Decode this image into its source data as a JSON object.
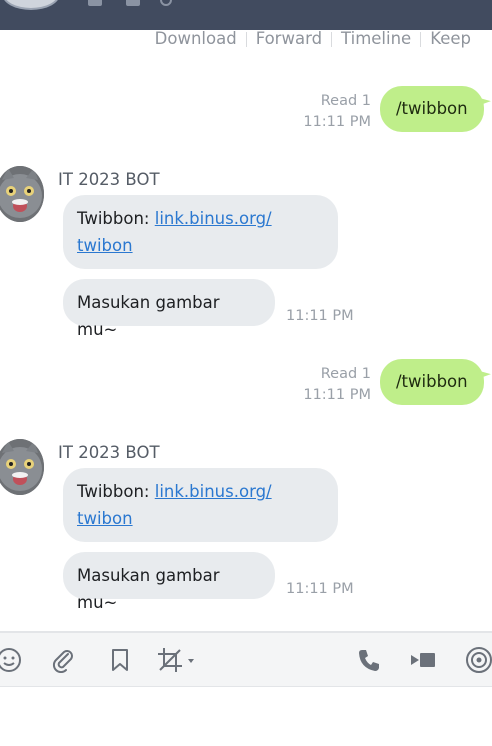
{
  "actions": {
    "download": "Download",
    "forward": "Forward",
    "timeline": "Timeline",
    "keep": "Keep"
  },
  "messages": [
    {
      "type": "outgoing",
      "text": "/twibbon",
      "read": "Read 1",
      "time": "11:11 PM"
    },
    {
      "type": "incoming",
      "sender": "IT 2023 BOT",
      "text_prefix": "Twibbon: ",
      "link_line1": "link.binus.org/",
      "link_line2": "twibon",
      "text2": "Masukan gambar mu~",
      "time": "11:11 PM"
    },
    {
      "type": "outgoing",
      "text": "/twibbon",
      "read": "Read 1",
      "time": "11:11 PM"
    },
    {
      "type": "incoming",
      "sender": "IT 2023 BOT",
      "text_prefix": "Twibbon: ",
      "link_line1": "link.binus.org/",
      "link_line2": "twibon",
      "text2": "Masukan gambar mu~",
      "time": "11:11 PM"
    }
  ],
  "toolbar": {
    "icons": [
      "emoji-icon",
      "attachment-icon",
      "bookmark-icon",
      "crop-icon",
      "call-icon",
      "video-icon",
      "live-icon"
    ]
  },
  "colors": {
    "header": "#414b5f",
    "outgoing_bubble": "#bfee8a",
    "incoming_bubble": "#e8ebee",
    "link": "#2b78d0"
  }
}
